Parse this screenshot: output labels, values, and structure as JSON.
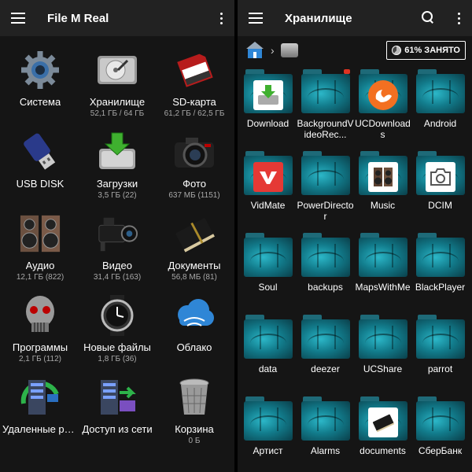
{
  "left": {
    "title": "File M Real",
    "items": [
      {
        "name": "Система",
        "sub": "",
        "icon": "gear-icon"
      },
      {
        "name": "Хранилище",
        "sub": "52,1 ГБ / 64 ГБ",
        "icon": "hard-drive-icon"
      },
      {
        "name": "SD-карта",
        "sub": "61,2 ГБ / 62,5 ГБ",
        "icon": "sd-card-icon"
      },
      {
        "name": "USB DISK",
        "sub": "",
        "icon": "usb-icon"
      },
      {
        "name": "Загрузки",
        "sub": "3,5 ГБ (22)",
        "icon": "download-icon"
      },
      {
        "name": "Фото",
        "sub": "637 МБ (1151)",
        "icon": "camera-icon"
      },
      {
        "name": "Аудио",
        "sub": "12,1 ГБ (822)",
        "icon": "speaker-icon"
      },
      {
        "name": "Видео",
        "sub": "31,4 ГБ (163)",
        "icon": "video-camera-icon"
      },
      {
        "name": "Документы",
        "sub": "56,8 МБ (81)",
        "icon": "book-icon"
      },
      {
        "name": "Программы",
        "sub": "2,1 ГБ (112)",
        "icon": "robot-skull-icon"
      },
      {
        "name": "Новые файлы",
        "sub": "1,8 ГБ (36)",
        "icon": "watch-icon"
      },
      {
        "name": "Облако",
        "sub": "",
        "icon": "cloud-icon"
      },
      {
        "name": "Удаленные ресурсы",
        "sub": "",
        "icon": "network-server-icon"
      },
      {
        "name": "Доступ из сети",
        "sub": "",
        "icon": "shared-server-icon"
      },
      {
        "name": "Корзина",
        "sub": "0 Б",
        "icon": "trash-icon"
      }
    ]
  },
  "right": {
    "title": "Хранилище",
    "usage": "61% ЗАНЯТО",
    "usage_percent": 61,
    "folders": [
      {
        "name": "Download",
        "badge": "download"
      },
      {
        "name": "BackgroundVideoRec...",
        "badge": ""
      },
      {
        "name": "UCDownloads",
        "badge": "uc"
      },
      {
        "name": "Android",
        "badge": ""
      },
      {
        "name": "VidMate",
        "badge": "vidmate"
      },
      {
        "name": "PowerDirector",
        "badge": ""
      },
      {
        "name": "Music",
        "badge": "music"
      },
      {
        "name": "DCIM",
        "badge": "camera"
      },
      {
        "name": "Soul",
        "badge": ""
      },
      {
        "name": "backups",
        "badge": ""
      },
      {
        "name": "MapsWithMe",
        "badge": ""
      },
      {
        "name": "BlackPlayer",
        "badge": ""
      },
      {
        "name": "data",
        "badge": ""
      },
      {
        "name": "deezer",
        "badge": ""
      },
      {
        "name": "UCShare",
        "badge": ""
      },
      {
        "name": "parrot",
        "badge": ""
      },
      {
        "name": "Артист",
        "badge": ""
      },
      {
        "name": "Alarms",
        "badge": ""
      },
      {
        "name": "documents",
        "badge": "documents"
      },
      {
        "name": "СберБанк",
        "badge": ""
      }
    ]
  }
}
